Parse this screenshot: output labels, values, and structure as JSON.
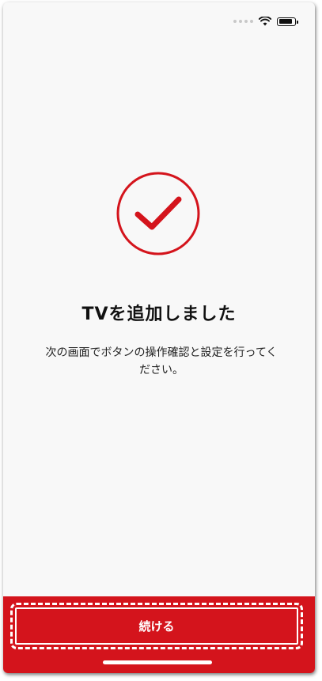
{
  "status_bar": {
    "wifi_icon": "wifi-icon",
    "battery_icon": "battery-icon",
    "battery_level": 0.85
  },
  "main": {
    "success_icon": "checkmark-circle-icon",
    "title": "TVを追加しました",
    "description": "次の画面でボタンの操作確認と設定を行ってください。"
  },
  "footer": {
    "continue_label": "続ける"
  },
  "colors": {
    "accent": "#d4141c",
    "background": "#f8f8f8",
    "text": "#111111"
  }
}
